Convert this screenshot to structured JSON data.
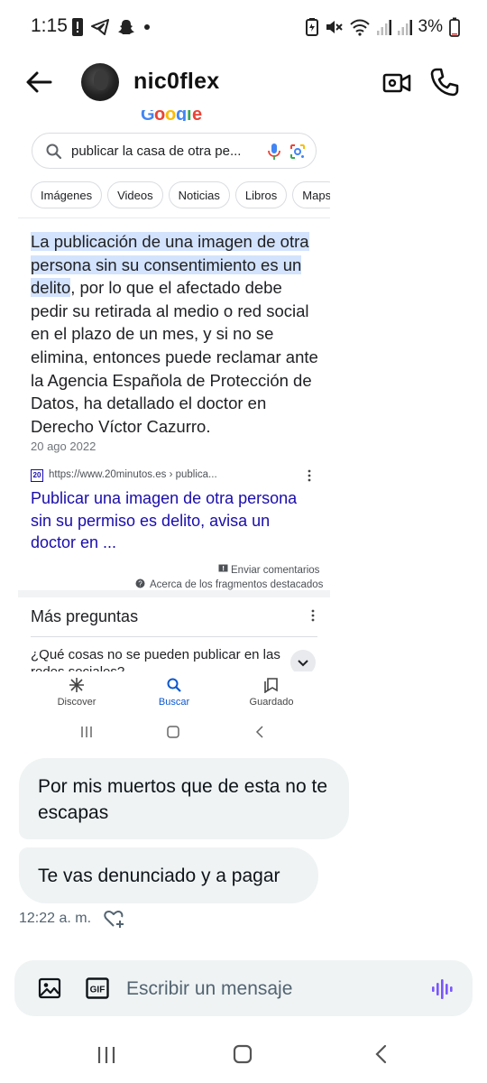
{
  "status_bar": {
    "time": "1:15",
    "battery_text": "3%"
  },
  "chat_header": {
    "username": "nic0flex"
  },
  "embedded_screenshot": {
    "search_query": "publicar la casa de otra pe...",
    "chips": [
      "Imágenes",
      "Videos",
      "Noticias",
      "Libros",
      "Maps"
    ],
    "answer_highlight_1": "La publicación de una imagen de otra persona sin su consentimiento es un delito",
    "answer_rest": ", por lo que el afectado debe pedir su retirada al medio o red social en el plazo de un mes, y si no se elimina, entonces puede reclamar ante la Agencia Española de Protección de Datos, ha detallado el doctor en Derecho Víctor Cazurro.",
    "date": "20 ago 2022",
    "favicon_text": "20",
    "source_url": "https://www.20minutos.es › publica...",
    "result_link": "Publicar una imagen de otra persona sin su permiso es delito, avisa un doctor en ...",
    "feedback": "Enviar comentarios",
    "about_snippets": "Acerca de los fragmentos destacados",
    "more_questions_title": "Más preguntas",
    "question_1": "¿Qué cosas no se pueden publicar en las redes sociales?",
    "nav": {
      "discover": "Discover",
      "search": "Buscar",
      "saved": "Guardado"
    }
  },
  "messages": [
    {
      "text": "Por mis muertos que de esta no te escapas"
    },
    {
      "text": "Te vas denunciado y a pagar"
    }
  ],
  "message_time": "12:22 a. m.",
  "composer": {
    "placeholder": "Escribir un mensaje"
  },
  "colors": {
    "highlight": "#d3e3fd",
    "link": "#1a0dab",
    "bubble": "#eff3f4",
    "voice_accent": "#7856ff"
  }
}
